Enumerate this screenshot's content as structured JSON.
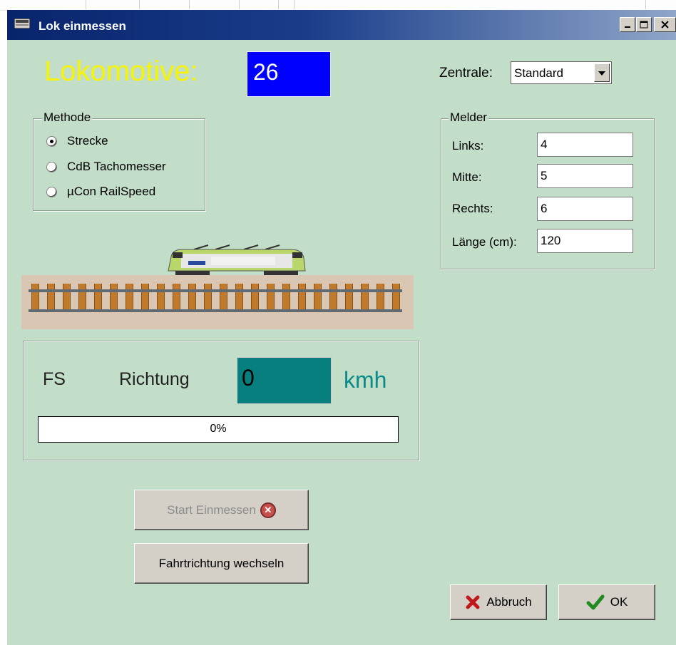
{
  "window": {
    "title": "Lok einmessen"
  },
  "lokomotive": {
    "label": "Lokomotive:",
    "number": "26"
  },
  "zentrale": {
    "label": "Zentrale:",
    "selected": "Standard"
  },
  "methode": {
    "title": "Methode",
    "options": [
      {
        "label": "Strecke",
        "checked": true
      },
      {
        "label": "CdB Tachomesser",
        "checked": false
      },
      {
        "label": "µCon RailSpeed",
        "checked": false
      }
    ]
  },
  "melder": {
    "title": "Melder",
    "fields": [
      {
        "label": "Links:",
        "value": "4"
      },
      {
        "label": "Mitte:",
        "value": "5"
      },
      {
        "label": "Rechts:",
        "value": "6"
      },
      {
        "label": "Länge (cm):",
        "value": "120"
      }
    ]
  },
  "measurement": {
    "fs_label": "FS",
    "richtung_label": "Richtung",
    "speed": "0",
    "unit": "kmh",
    "progress_text": "0%",
    "progress_fraction": 0
  },
  "buttons": {
    "start": "Start Einmessen",
    "richtung": "Fahrtrichtung wechseln",
    "abbruch": "Abbruch",
    "ok": "OK"
  },
  "colors": {
    "background": "#c3dec8",
    "lok_label": "#f5f30a",
    "lok_box": "#0000ff",
    "speed_box": "#087f7f",
    "unit": "#0b8a8a"
  }
}
